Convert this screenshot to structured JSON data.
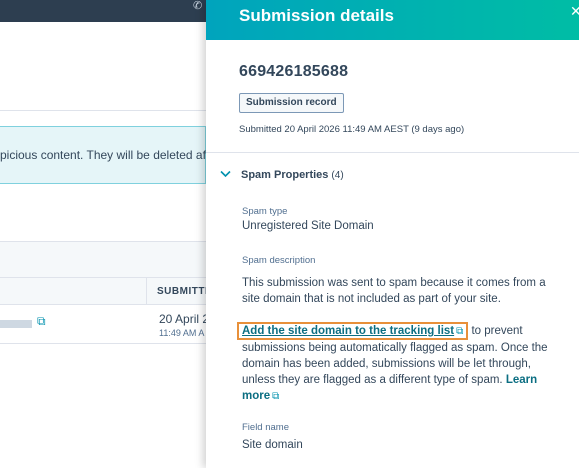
{
  "background": {
    "banner_text": "picious content. They will be deleted aft",
    "column_header": "SUBMITTE",
    "row_date": "20 April 2",
    "row_time": "11:49 AM A"
  },
  "panel": {
    "title": "Submission details",
    "submission_id": "669426185688",
    "record_badge": "Submission record",
    "submitted_text": "Submitted 20 April 2026 11:49 AM AEST (9 days ago)",
    "section": {
      "title": "Spam Properties",
      "count": "(4)"
    },
    "properties": {
      "spam_type_label": "Spam type",
      "spam_type_value": "Unregistered Site Domain",
      "spam_desc_label": "Spam description",
      "spam_desc_value": "This submission was sent to spam because it comes from a site domain that is not included as part of your site.",
      "tracking_link": "Add the site domain to the tracking list",
      "tracking_text": "to prevent submissions being automatically flagged as spam. Once the domain has been added, submissions will be let through, unless they are flagged as a different type of spam.",
      "learn_more": "Learn more",
      "field_name_label": "Field name",
      "field_name_value": "Site domain"
    }
  },
  "icons": {
    "external_link": "external-link-icon",
    "chevron": "chevron-down-icon",
    "close": "close-icon",
    "phone": "phone-icon"
  },
  "colors": {
    "header_start": "#00a4bd",
    "header_end": "#00bda5",
    "link": "#0b6e82",
    "highlight": "#e8903a",
    "text": "#33475b"
  }
}
